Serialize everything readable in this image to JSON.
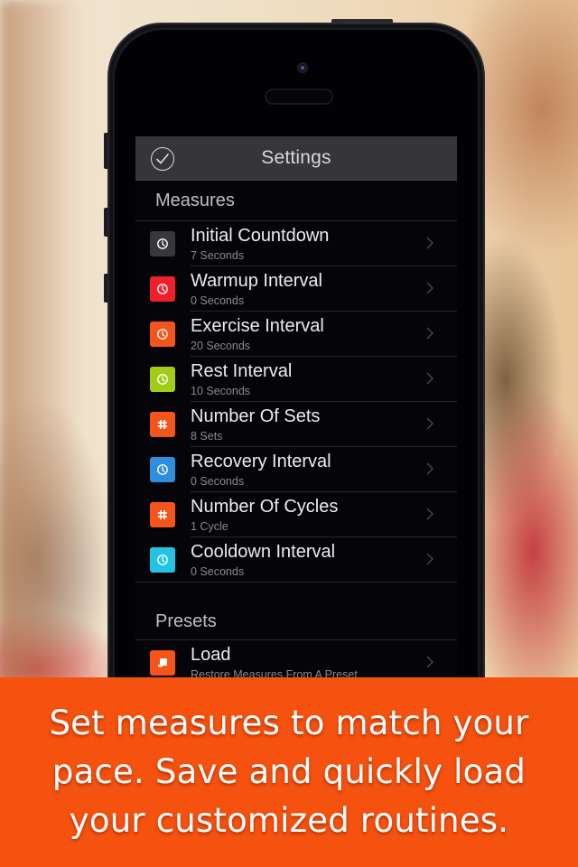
{
  "colors": {
    "caption_bg": "#f5510f",
    "navbar_bg": "#36363a",
    "screen_bg": "#050409"
  },
  "navbar": {
    "title": "Settings",
    "left_icon": "checkmark-circle-icon"
  },
  "sections": {
    "measures": {
      "title": "Measures",
      "items": [
        {
          "label": "Initial Countdown",
          "value": "7 Seconds",
          "icon": "clock-icon",
          "color": "#38383c"
        },
        {
          "label": "Warmup Interval",
          "value": "0 Seconds",
          "icon": "clock-icon",
          "color": "#f0202a"
        },
        {
          "label": "Exercise Interval",
          "value": "20 Seconds",
          "icon": "clock-icon",
          "color": "#f5541a"
        },
        {
          "label": "Rest Interval",
          "value": "10 Seconds",
          "icon": "clock-icon",
          "color": "#a2cc1a"
        },
        {
          "label": "Number Of Sets",
          "value": "8 Sets",
          "icon": "hash-icon",
          "color": "#f5541a"
        },
        {
          "label": "Recovery Interval",
          "value": "0 Seconds",
          "icon": "clock-icon",
          "color": "#2f8fdc"
        },
        {
          "label": "Number Of Cycles",
          "value": "1 Cycle",
          "icon": "hash-icon",
          "color": "#f5541a"
        },
        {
          "label": "Cooldown Interval",
          "value": "0 Seconds",
          "icon": "clock-icon",
          "color": "#24c3e4"
        }
      ]
    },
    "presets": {
      "title": "Presets",
      "items": [
        {
          "label": "Load",
          "value": "Restore Measures From A Preset",
          "icon": "load-preset-icon",
          "color": "#f5541a"
        }
      ]
    }
  },
  "caption": {
    "text": "Set measures to match your pace. Save and quickly load your customized routines."
  }
}
